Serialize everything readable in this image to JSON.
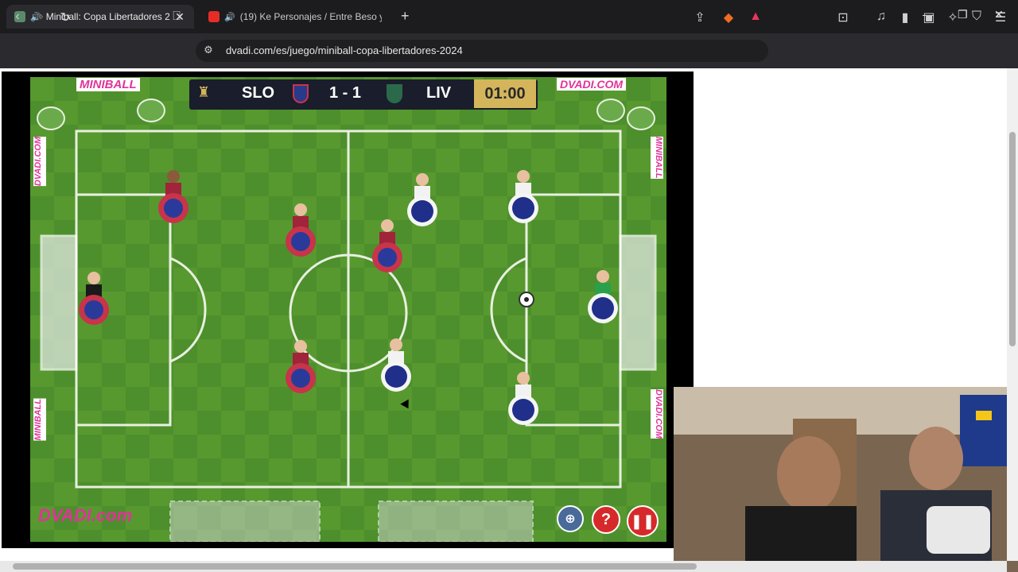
{
  "browser": {
    "tabs": [
      {
        "title": "Miniball: Copa Libertadores 2",
        "active": true
      },
      {
        "title": "(19) Ke Personajes / Entre Beso y",
        "active": false
      }
    ],
    "url": "dvadi.com/es/juego/miniball-copa-libertadores-2024"
  },
  "game": {
    "banner_left": "MINIBALL",
    "banner_right": "DVADI.COM",
    "side_banner_left_top": "DVADI.COM",
    "side_banner_left_bottom": "MINIBALL",
    "side_banner_right_top": "MINIBALL",
    "side_banner_right_bottom": "DVADI.COM",
    "home_team": "SLO",
    "away_team": "LIV",
    "score": "1 - 1",
    "timer": "01:00",
    "logo": "DVADI.com",
    "colors": {
      "home": "#c8344a",
      "away": "#1f2f8a",
      "field": "#4a8a2a"
    }
  }
}
